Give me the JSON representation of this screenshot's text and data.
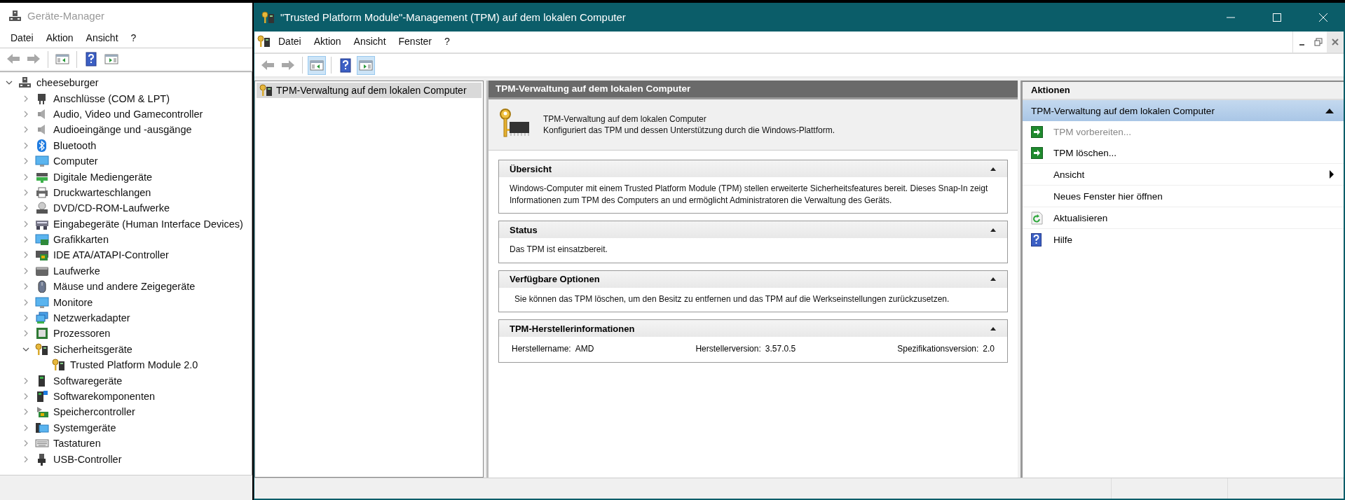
{
  "device_manager": {
    "title": "Geräte-Manager",
    "menu": [
      "Datei",
      "Aktion",
      "Ansicht",
      "?"
    ],
    "toolbar": [
      {
        "kind": "back",
        "disabled": true
      },
      {
        "kind": "forward",
        "disabled": true
      },
      {
        "kind": "tree-pane",
        "pressed": false
      },
      {
        "kind": "help",
        "pressed": false
      },
      {
        "kind": "action-pane",
        "pressed": false
      }
    ],
    "tree": {
      "label": "cheeseburger",
      "expanded": true,
      "children": [
        {
          "label": "Anschlüsse (COM & LPT)",
          "expanded": false
        },
        {
          "label": "Audio, Video und Gamecontroller",
          "expanded": false
        },
        {
          "label": "Audioeingänge und -ausgänge",
          "expanded": false
        },
        {
          "label": "Bluetooth",
          "expanded": false
        },
        {
          "label": "Computer",
          "expanded": false
        },
        {
          "label": "Digitale Mediengeräte",
          "expanded": false
        },
        {
          "label": "Druckwarteschlangen",
          "expanded": false
        },
        {
          "label": "DVD/CD-ROM-Laufwerke",
          "expanded": false
        },
        {
          "label": "Eingabegeräte (Human Interface Devices)",
          "expanded": false
        },
        {
          "label": "Grafikkarten",
          "expanded": false
        },
        {
          "label": "IDE ATA/ATAPI-Controller",
          "expanded": false
        },
        {
          "label": "Laufwerke",
          "expanded": false
        },
        {
          "label": "Mäuse und andere Zeigegeräte",
          "expanded": false
        },
        {
          "label": "Monitore",
          "expanded": false
        },
        {
          "label": "Netzwerkadapter",
          "expanded": false
        },
        {
          "label": "Prozessoren",
          "expanded": false
        },
        {
          "label": "Sicherheitsgeräte",
          "expanded": true,
          "children": [
            {
              "label": "Trusted Platform Module 2.0"
            }
          ]
        },
        {
          "label": "Softwaregeräte",
          "expanded": false
        },
        {
          "label": "Softwarekomponenten",
          "expanded": false
        },
        {
          "label": "Speichercontroller",
          "expanded": false
        },
        {
          "label": "Systemgeräte",
          "expanded": false
        },
        {
          "label": "Tastaturen",
          "expanded": false
        },
        {
          "label": "USB-Controller",
          "expanded": false
        }
      ]
    }
  },
  "tpm_window": {
    "title": "\"Trusted Platform Module\"-Management (TPM) auf dem lokalen Computer",
    "menu": [
      "Datei",
      "Aktion",
      "Ansicht",
      "Fenster",
      "?"
    ],
    "toolbar": [
      {
        "kind": "back",
        "disabled": true
      },
      {
        "kind": "forward",
        "disabled": true
      },
      {
        "kind": "tree-pane",
        "pressed": true
      },
      {
        "kind": "help",
        "pressed": false
      },
      {
        "kind": "action-pane",
        "pressed": true
      }
    ],
    "scope_tree": [
      {
        "label": "TPM-Verwaltung auf dem lokalen Computer",
        "selected": true
      }
    ],
    "content": {
      "header": "TPM-Verwaltung auf dem lokalen Computer",
      "intro_title": "TPM-Verwaltung auf dem lokalen Computer",
      "intro_text": "Konfiguriert das TPM und dessen Unterstützung durch die Windows-Plattform.",
      "sections": [
        {
          "kind": "text",
          "title": "Übersicht",
          "expanded": true,
          "text": "Windows-Computer mit einem Trusted Platform Module (TPM) stellen erweiterte Sicherheitsfeatures bereit. Dieses Snap-In zeigt Informationen zum TPM des Computers an und ermöglicht Administratoren die Verwaltung des Geräts."
        },
        {
          "kind": "text",
          "title": "Status",
          "expanded": true,
          "text": "Das TPM ist einsatzbereit."
        },
        {
          "kind": "text",
          "title": "Verfügbare Optionen",
          "expanded": true,
          "text": "Sie können das TPM löschen, um den Besitz zu entfernen und das TPM auf die Werkseinstellungen zurückzusetzen."
        },
        {
          "kind": "fields",
          "title": "TPM-Herstellerinformationen",
          "expanded": true,
          "fields": [
            {
              "label": "Herstellername:",
              "value": "AMD"
            },
            {
              "label": "Herstellerversion:",
              "value": "3.57.0.5"
            },
            {
              "label": "Spezifikationsversion:",
              "value": "2.0"
            }
          ]
        }
      ]
    },
    "actions": {
      "header": "Aktionen",
      "group": "TPM-Verwaltung auf dem lokalen Computer",
      "expanded": true,
      "items": [
        {
          "kind": "run",
          "label": "TPM vorbereiten...",
          "disabled": true
        },
        {
          "kind": "run",
          "label": "TPM löschen...",
          "disabled": false
        },
        {
          "kind": "submenu",
          "label": "Ansicht",
          "disabled": false
        },
        {
          "kind": "plain",
          "label": "Neues Fenster hier öffnen",
          "disabled": false
        },
        {
          "kind": "refresh",
          "label": "Aktualisieren",
          "disabled": false
        },
        {
          "kind": "help",
          "label": "Hilfe",
          "disabled": false
        }
      ]
    }
  }
}
